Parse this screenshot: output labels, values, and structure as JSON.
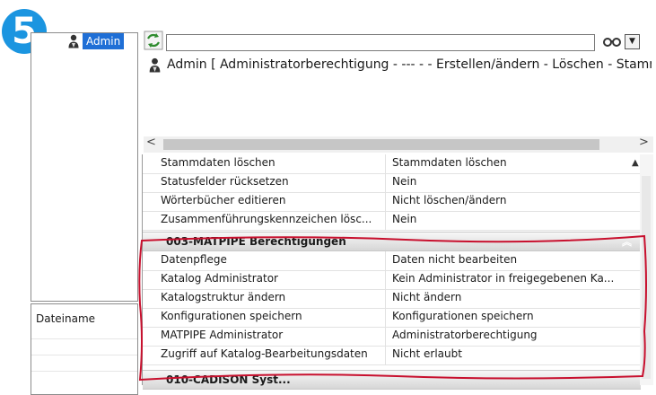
{
  "step_badge": "5",
  "left_pane": {
    "selected_user": "Admin",
    "column_header": "Dateiname"
  },
  "toolbar": {
    "search_value": "",
    "binoculars_icon": "binoculars-icon",
    "dropdown_icon": "chevron-down-icon"
  },
  "user_line": {
    "text": "Admin   [ Administratorberechtigung - --- -  - Erstellen/ändern - Löschen - Stamm"
  },
  "properties": {
    "rows_top": [
      {
        "name": "Stammdaten löschen",
        "value": "Stammdaten löschen"
      },
      {
        "name": "Statusfelder rücksetzen",
        "value": "Nein"
      },
      {
        "name": "Wörterbücher editieren",
        "value": "Nicht löschen/ändern"
      },
      {
        "name": "Zusammenführungskennzeichen lösc...",
        "value": "Nein"
      }
    ],
    "category_1": "003-MATPIPE Berechtigungen",
    "rows_cat1": [
      {
        "name": "Datenpflege",
        "value": "Daten nicht bearbeiten"
      },
      {
        "name": "Katalog Administrator",
        "value": "Kein Administrator in freigegebenen Ka..."
      },
      {
        "name": "Katalogstruktur ändern",
        "value": "Nicht ändern"
      },
      {
        "name": "Konfigurationen speichern",
        "value": "Konfigurationen speichern"
      },
      {
        "name": "MATPIPE Administrator",
        "value": "Administratorberechtigung"
      },
      {
        "name": "Zugriff auf Katalog-Bearbeitungsdaten",
        "value": "Nicht erlaubt"
      }
    ],
    "category_2": "010-CADISON Syst..."
  },
  "colors": {
    "badge": "#1b95e0",
    "selection": "#1f6fd6",
    "highlight": "#c8102e"
  }
}
